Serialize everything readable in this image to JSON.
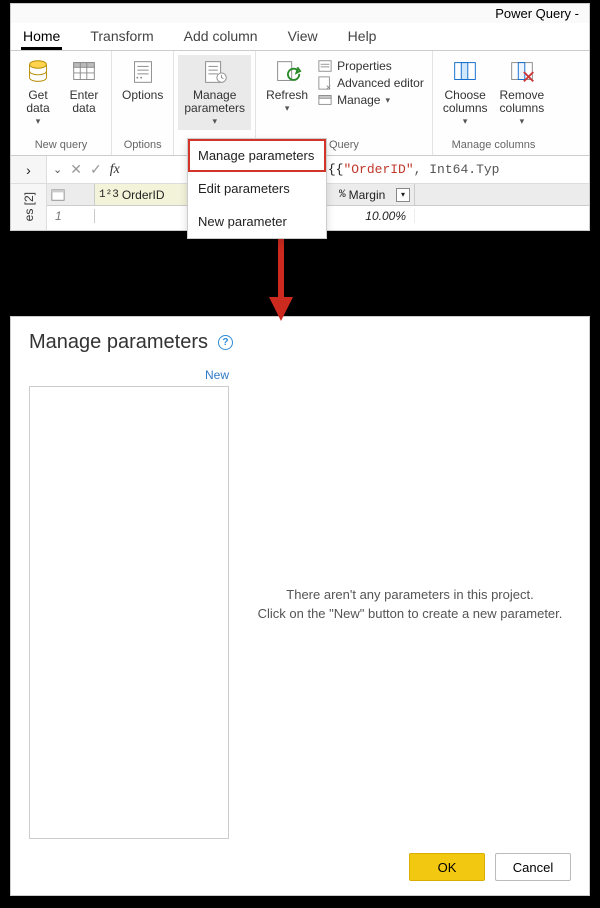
{
  "app_title": "Power Query -",
  "tabs": {
    "home": "Home",
    "transform": "Transform",
    "addcolumn": "Add column",
    "view": "View",
    "help": "Help"
  },
  "ribbon": {
    "getdata": "Get\ndata",
    "enterdata": "Enter\ndata",
    "options": "Options",
    "manageparams": "Manage\nparameters",
    "refresh": "Refresh",
    "properties": "Properties",
    "advanced": "Advanced editor",
    "manage": "Manage",
    "choosecols": "Choose\ncolumns",
    "removecols": "Remove\ncolumns",
    "grp_newquery": "New query",
    "grp_options": "Options",
    "grp_query": "Query",
    "grp_managecols": "Manage columns"
  },
  "dropdown": {
    "manage": "Manage parameters",
    "edit": "Edit parameters",
    "new": "New parameter"
  },
  "formula": {
    "prefix": "mnTypes(Source, {{",
    "field": "\"OrderID\"",
    "rest": ", Int64.Typ"
  },
  "side_label": "es [2]",
  "columns": {
    "orderid_type": "1²3",
    "orderid": "OrderID",
    "margin_type": "%",
    "margin": "Margin"
  },
  "data": {
    "row1": "1",
    "margin_val": "10.00%"
  },
  "dialog": {
    "title": "Manage parameters",
    "new": "New",
    "empty1": "There aren't any parameters in this project.",
    "empty2": "Click on the \"New\" button to create a new parameter.",
    "ok": "OK",
    "cancel": "Cancel"
  }
}
